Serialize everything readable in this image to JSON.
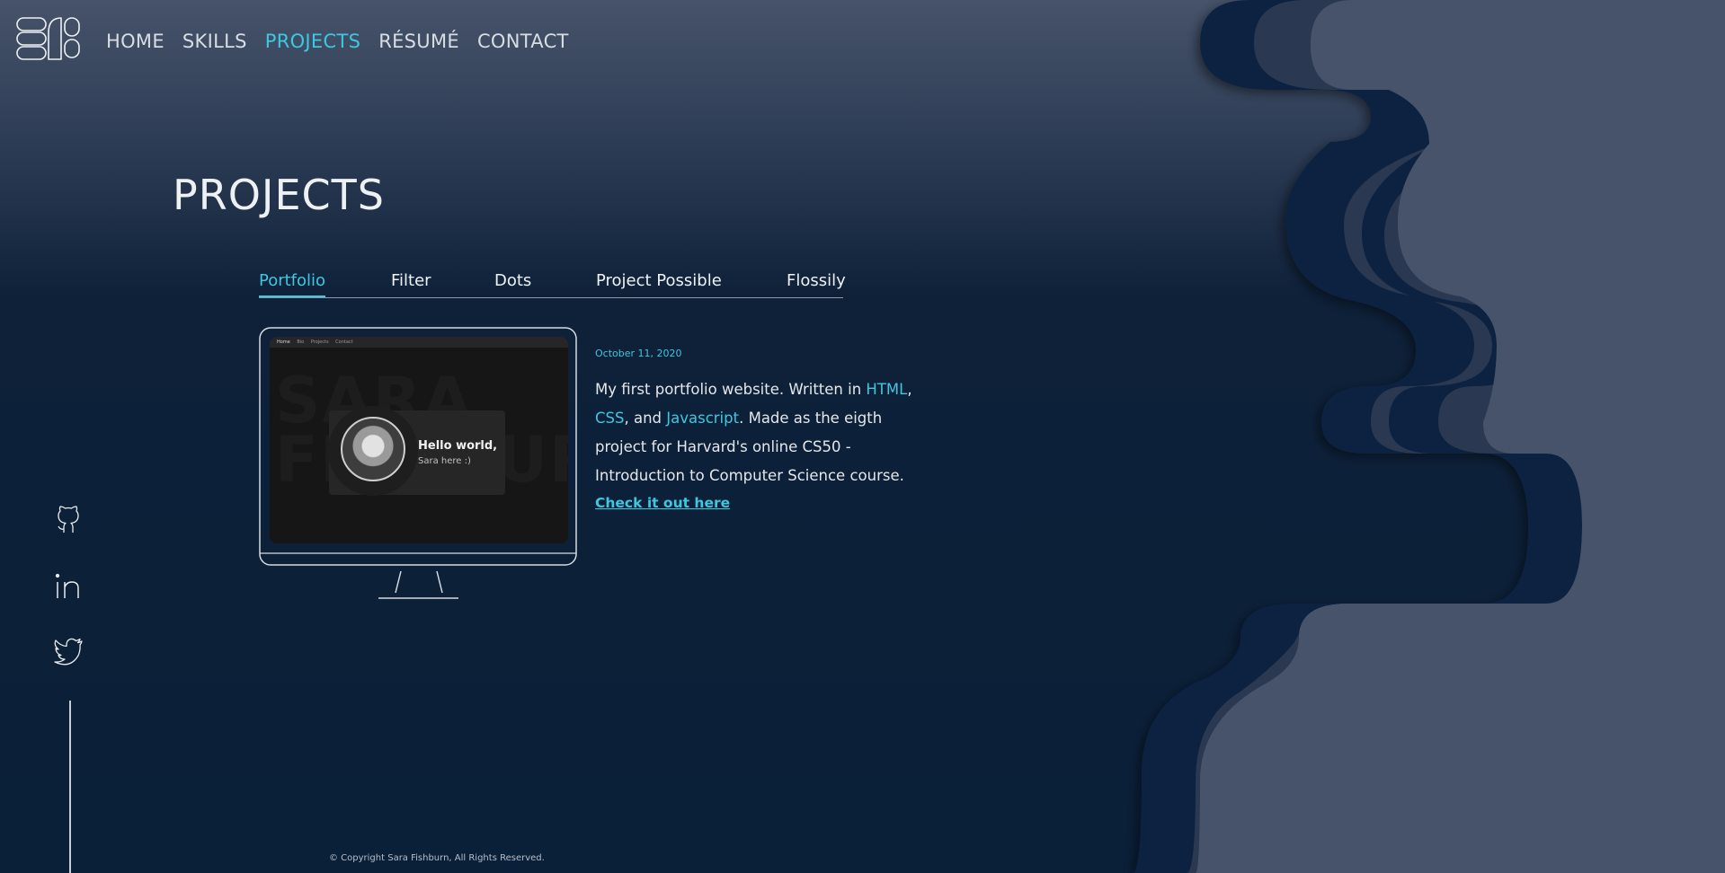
{
  "nav": {
    "items": [
      {
        "label": "HOME"
      },
      {
        "label": "SKILLS"
      },
      {
        "label": "PROJECTS",
        "active": true
      },
      {
        "label": "RÉSUMÉ"
      },
      {
        "label": "CONTACT"
      }
    ]
  },
  "page": {
    "title": "PROJECTS"
  },
  "tabs": [
    {
      "label": "Portfolio",
      "active": true
    },
    {
      "label": "Filter"
    },
    {
      "label": "Dots"
    },
    {
      "label": "Project Possible"
    },
    {
      "label": "Flossily"
    }
  ],
  "project": {
    "date": "October 11, 2020",
    "desc_prefix": "My first portfolio website. Written in ",
    "tech": [
      "HTML",
      "CSS",
      "Javascript"
    ],
    "sep_1": ",",
    "sep_2": ", and ",
    "desc_suffix": ". Made as the eigth project for Harvard's online CS50 - Introduction to Computer Science course.",
    "cta": "Check it out here",
    "preview": {
      "nav_items": [
        "Home",
        "Bio",
        "Projects",
        "Contact"
      ],
      "bg_text_1": "SARA",
      "bg_text_2": "FISHBURN",
      "greeting": "Hello world,",
      "subgreeting": "Sara here :)"
    }
  },
  "social": {
    "icons": [
      "github-icon",
      "linkedin-icon",
      "twitter-icon"
    ]
  },
  "footer": {
    "copyright": "© Copyright Sara Fishburn, All Rights Reserved."
  },
  "colors": {
    "accent": "#3ec7e0",
    "background": "#0a1f38",
    "wave_light": "#46536a",
    "wave_mid": "#2a3851",
    "wave_dark": "#0c2340"
  }
}
